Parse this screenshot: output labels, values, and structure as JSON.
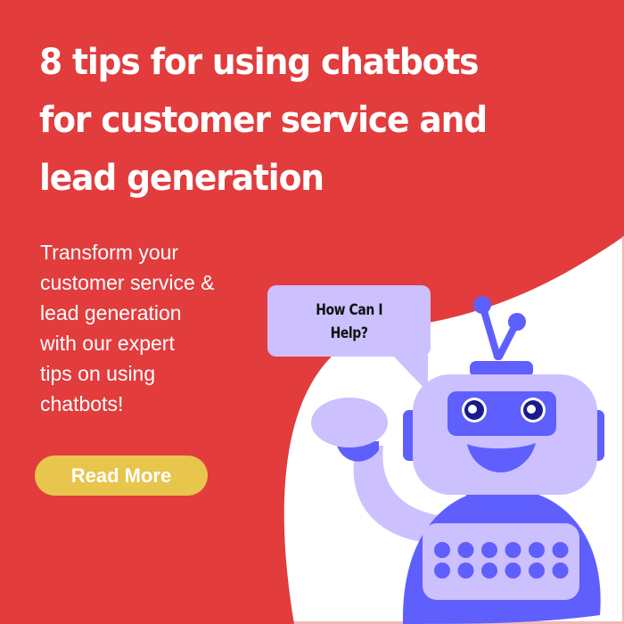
{
  "headline": {
    "line1": "8 tips for using chatbots",
    "line2": "for customer service and",
    "line3": "lead generation"
  },
  "subtitle": {
    "lines": [
      "Transform your",
      "customer service &",
      "lead generation",
      "with our expert",
      "tips on using",
      "chatbots!"
    ]
  },
  "cta": {
    "label": "Read More"
  },
  "speech_bubble": {
    "line1": "How Can I",
    "line2": "Help?"
  },
  "illustration": {
    "subject": "robot-waving",
    "eye_count": 2,
    "keypad_dot_rows": 2,
    "keypad_dot_cols": 6
  },
  "colors": {
    "background": "#e23c3d",
    "accent_white": "#ffffff",
    "button": "#e8c54d",
    "robot_light": "#ccc0fe",
    "robot_dark": "#5f5ffe",
    "eye_pupil": "#1a1a8c"
  }
}
